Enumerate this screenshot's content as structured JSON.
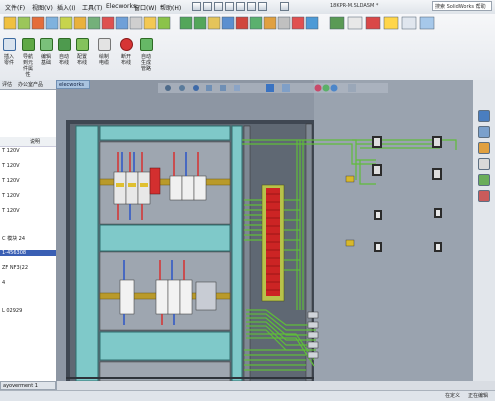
{
  "menubar": {
    "items": [
      "文件(F)",
      "视图(V)",
      "插入(I)",
      "工具(T)",
      "Elecworks",
      "窗口(W)",
      "帮助(H)"
    ],
    "document_title": "18KPR-M.SLDASM *",
    "search_placeholder": "搜索 SolidWorks 帮助"
  },
  "command_manager": {
    "labels": [
      "插入零件",
      "导航到元件属性",
      "编辑基础",
      "自动布线",
      "配置布线",
      "绘制电缆",
      "断开布线",
      "自动生成管路"
    ]
  },
  "left_panel": {
    "tabs": [
      "评估",
      "办公室产品",
      "elecworks"
    ],
    "header": "说明",
    "rows": [
      "T 120V",
      "T 120V",
      "T 120V",
      "T 120V",
      "T 120V",
      "C 模块 24",
      "1-456308",
      "ZF NF3(22",
      "4",
      "L 02929"
    ]
  },
  "viewport": {
    "document_tab": "elecworks"
  },
  "bottom_tab": "ayoverment 1",
  "status": {
    "left": "",
    "right": [
      "在定义",
      "正在编辑"
    ]
  },
  "colors": {
    "cabinet_panel": "#7fc9c9",
    "din_rail": "#b99a2a",
    "wire_green": "#5fbd3a",
    "terminal_red": "#cc2424",
    "background": "#8d96a3"
  }
}
